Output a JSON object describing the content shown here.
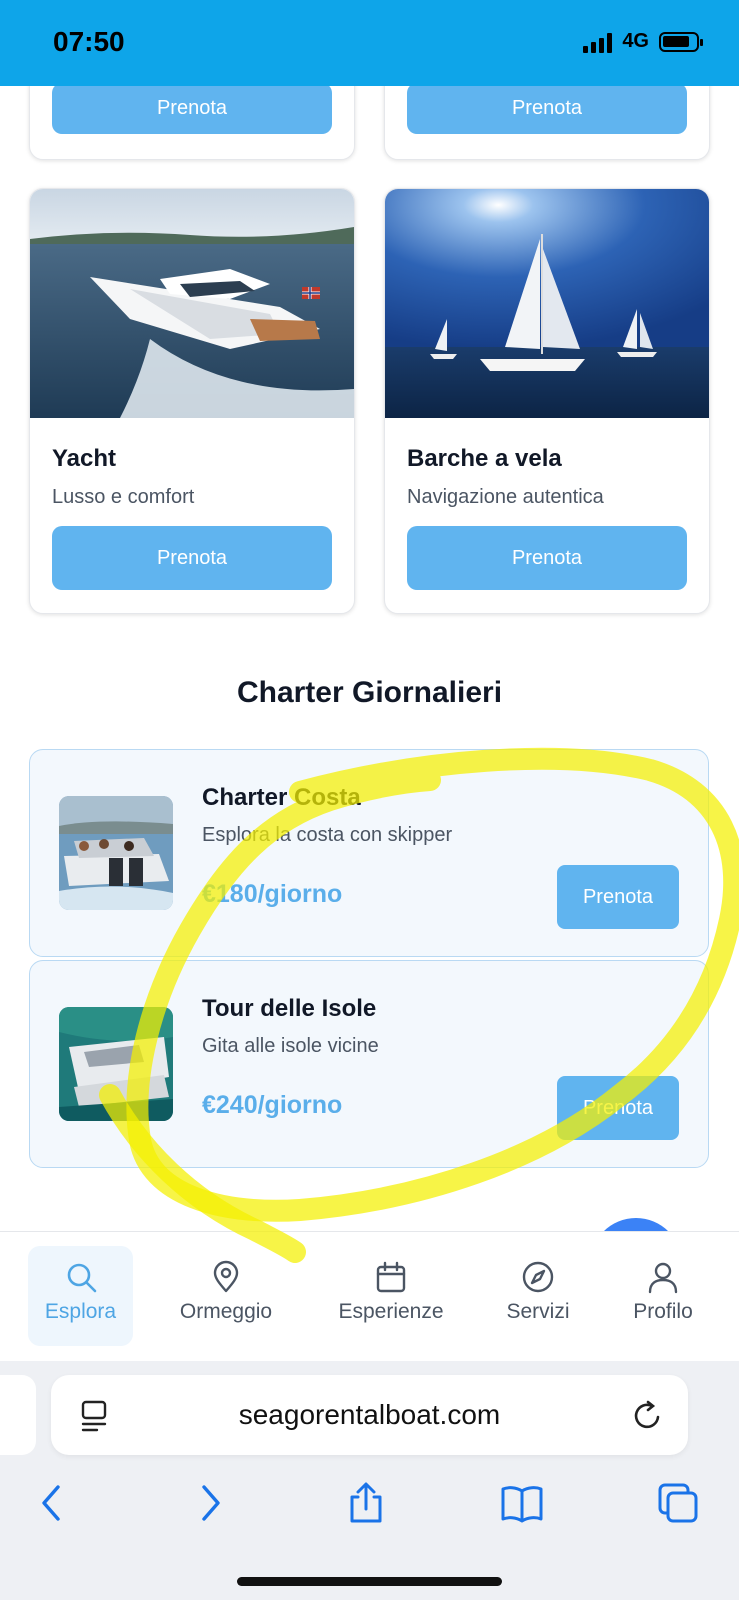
{
  "status": {
    "time": "07:50",
    "network": "4G"
  },
  "top_cards": [
    {
      "button": "Prenota"
    },
    {
      "button": "Prenota"
    }
  ],
  "rental_cards": [
    {
      "title": "Yacht",
      "subtitle": "Lusso e comfort",
      "button": "Prenota"
    },
    {
      "title": "Barche a vela",
      "subtitle": "Navigazione autentica",
      "button": "Prenota"
    }
  ],
  "charter_section": {
    "title": "Charter Giornalieri",
    "items": [
      {
        "title": "Charter Costa",
        "subtitle": "Esplora la costa con skipper",
        "price": "€180/giorno",
        "button": "Prenota"
      },
      {
        "title": "Tour delle Isole",
        "subtitle": "Gita alle isole vicine",
        "price": "€240/giorno",
        "button": "Prenota"
      }
    ]
  },
  "tabbar": {
    "active": "Esplora",
    "tabs": [
      {
        "label": "Esplora",
        "icon": "search-icon"
      },
      {
        "label": "Ormeggio",
        "icon": "map-pin-icon"
      },
      {
        "label": "Esperienze",
        "icon": "calendar-icon"
      },
      {
        "label": "Servizi",
        "icon": "compass-icon"
      },
      {
        "label": "Profilo",
        "icon": "user-icon"
      }
    ]
  },
  "browser": {
    "url": "seagorentalboat.com",
    "toolbar_icons": [
      "back-icon",
      "forward-icon",
      "share-icon",
      "bookmarks-icon",
      "tabs-icon"
    ]
  },
  "colors": {
    "status_bar": "#0ea5e9",
    "button": "#60b4ef",
    "price": "#5aaeea",
    "highlighter": "#f4f000"
  }
}
